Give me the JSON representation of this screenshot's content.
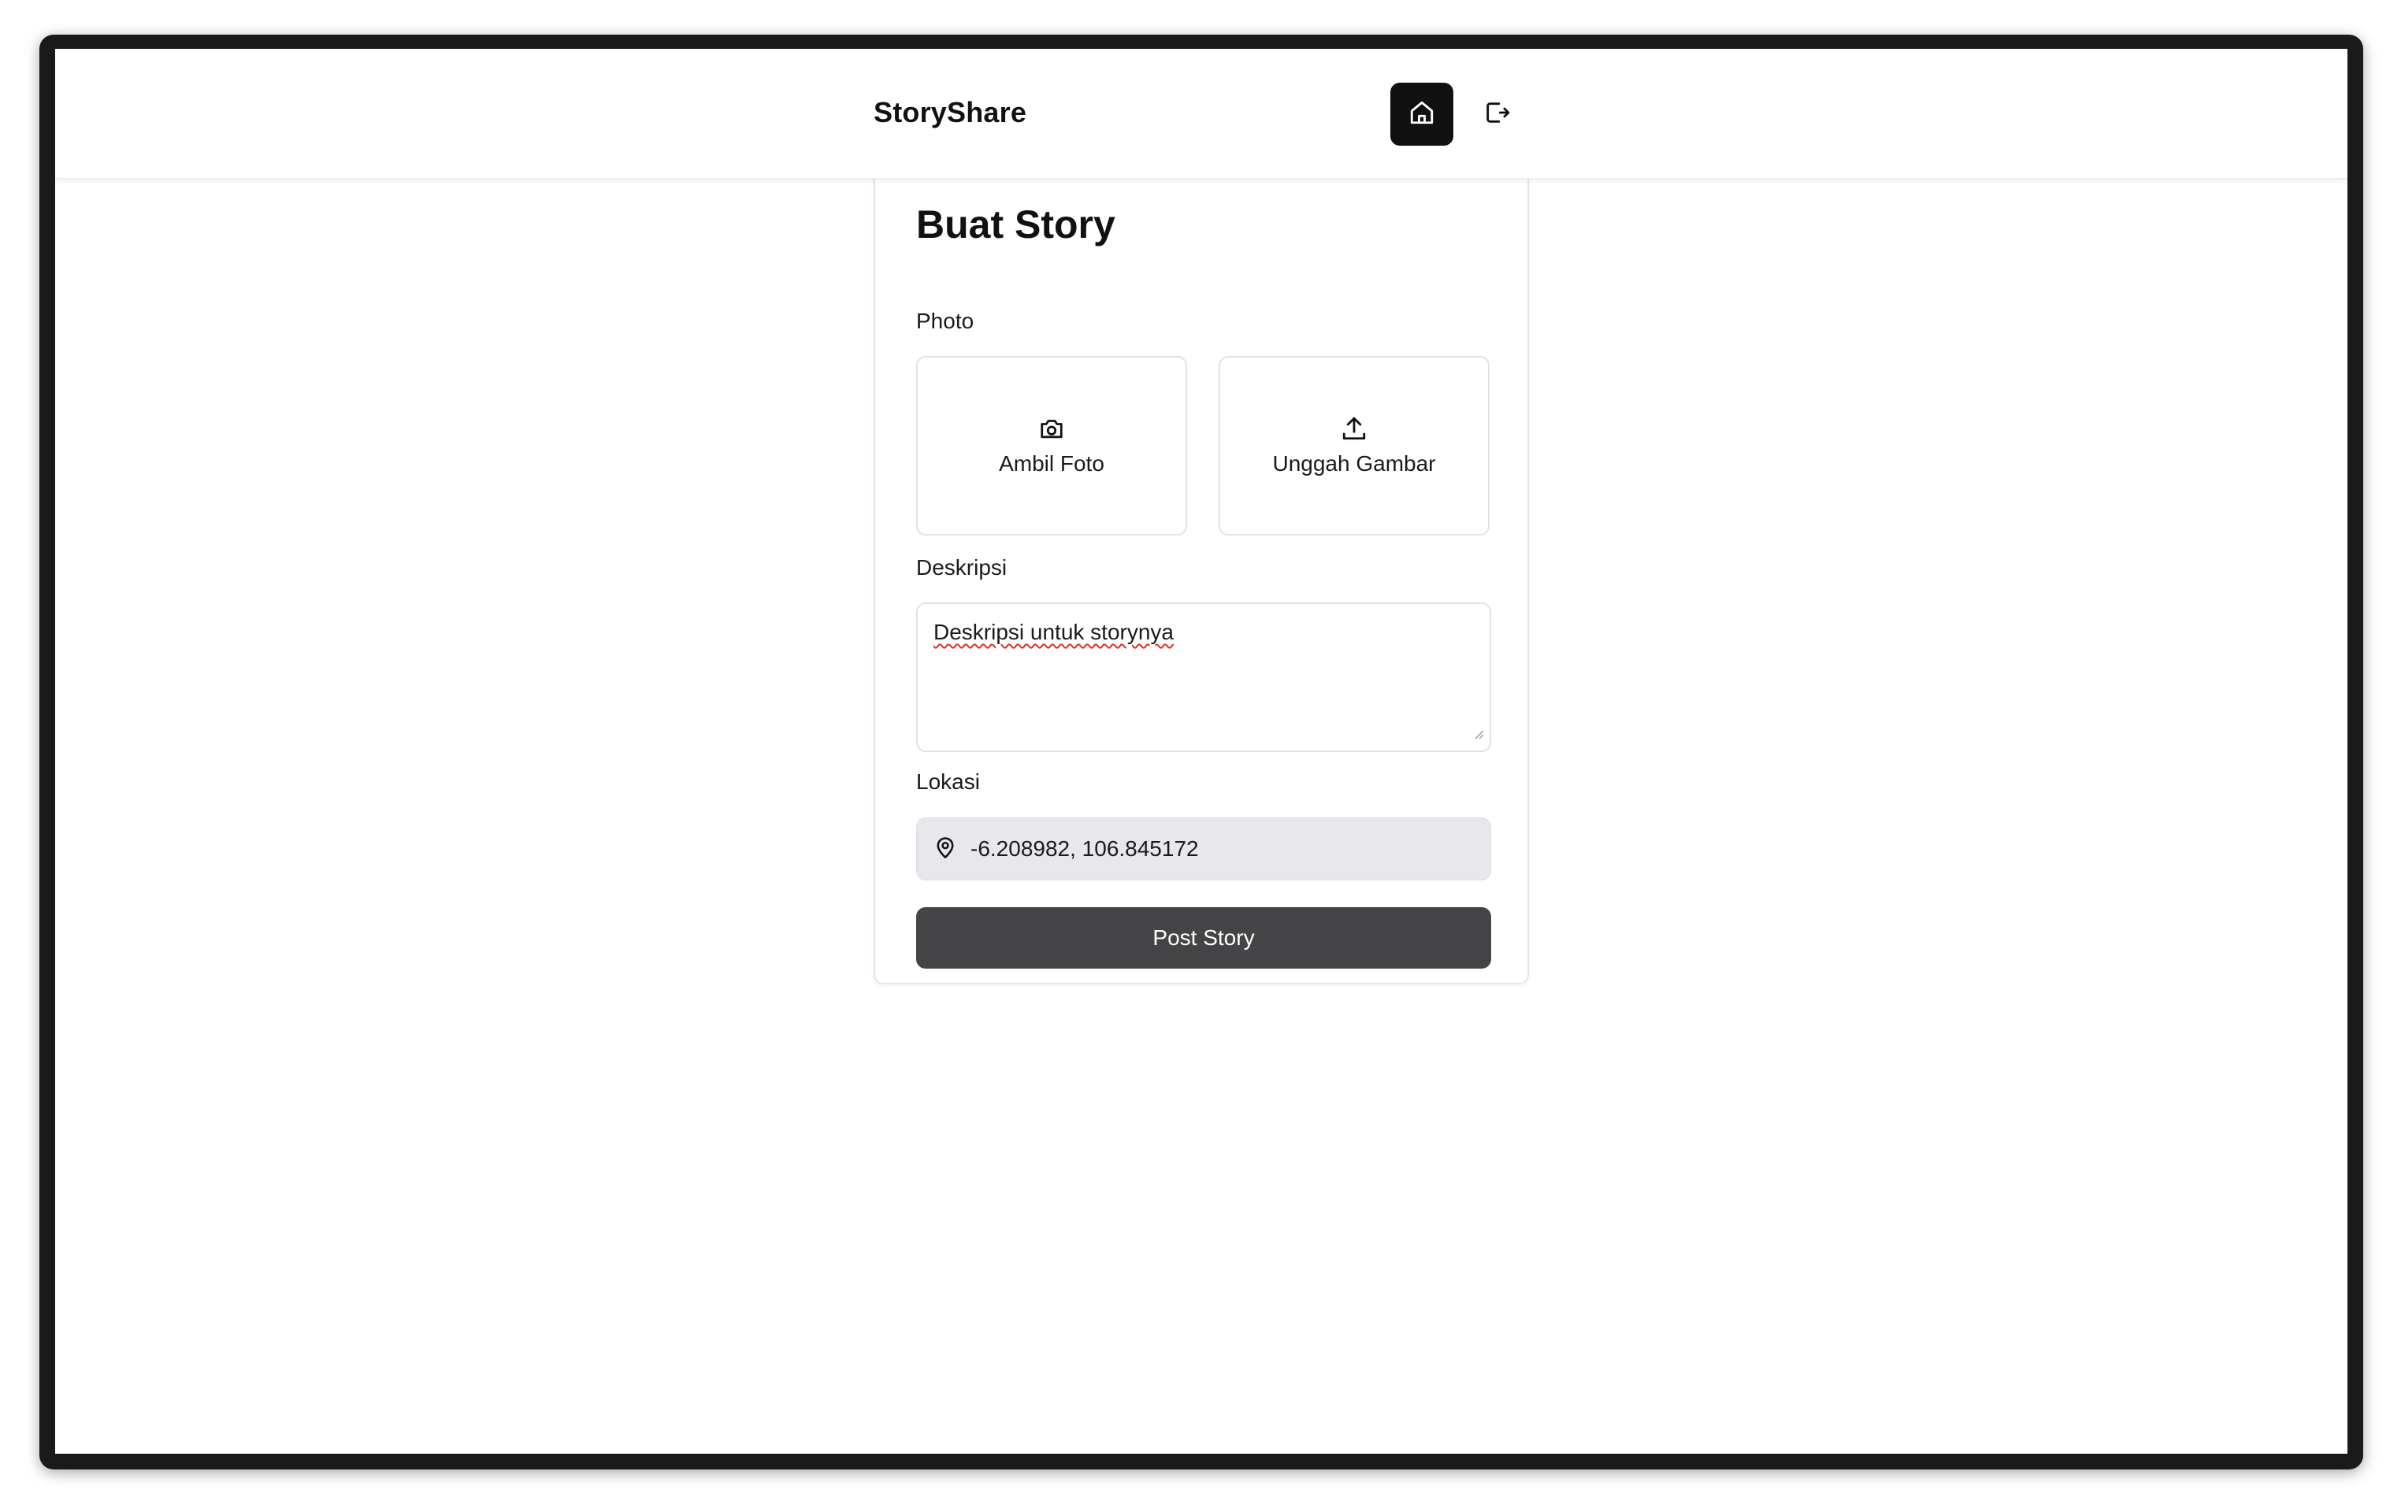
{
  "header": {
    "brand": "StoryShare",
    "nav": {
      "home_icon": "home-icon",
      "logout_icon": "logout-icon"
    }
  },
  "form": {
    "title": "Buat Story",
    "photo": {
      "label": "Photo",
      "options": [
        {
          "label": "Ambil Foto",
          "icon": "camera-icon"
        },
        {
          "label": "Unggah Gambar",
          "icon": "upload-icon"
        }
      ]
    },
    "description": {
      "label": "Deskripsi",
      "value": "Deskripsi untuk storynya"
    },
    "location": {
      "label": "Lokasi",
      "icon": "map-pin-icon",
      "value": "-6.208982, 106.845172"
    },
    "submit_label": "Post Story"
  },
  "colors": {
    "brand_dark": "#111111",
    "button_bg": "#444447",
    "location_bg": "#e8e8ec",
    "spellcheck": "#d93025"
  }
}
